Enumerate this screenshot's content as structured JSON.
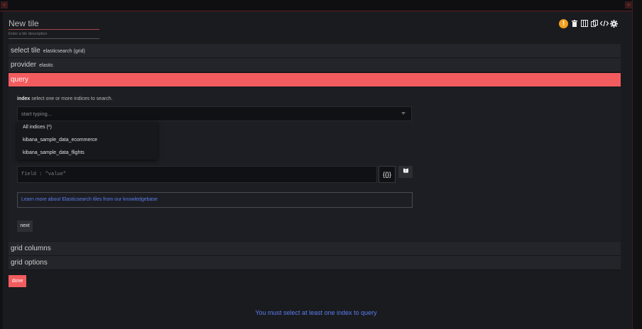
{
  "tile": {
    "title": "New tile",
    "description_placeholder": "Enter a tile description"
  },
  "toolbar": {
    "icons": [
      "warning-icon",
      "trash-icon",
      "columns-icon",
      "copy-icon",
      "code-icon",
      "gear-icon"
    ],
    "warning_glyph": "!"
  },
  "sections": {
    "select_tile": {
      "label": "select tile",
      "value": "elasticsearch (grid)"
    },
    "provider": {
      "label": "provider",
      "value": "elastic"
    },
    "query": {
      "label": "query"
    },
    "grid_columns": {
      "label": "grid columns"
    },
    "grid_options": {
      "label": "grid options"
    }
  },
  "query": {
    "index_label": "index",
    "index_hint": "select one or more indices to search.",
    "index_placeholder": "start typing...",
    "index_options": [
      "All indices (*)",
      "kibana_sample_data_ecommerce",
      "kibana_sample_data_flights"
    ],
    "query_placeholder": "field : \"value\"",
    "braces_label": "{{}}",
    "kb_link": "Learn more about Elasticsearch tiles from our knowledgebase",
    "next_label": "next"
  },
  "done_label": "done",
  "validation_message": "You must select at least one index to query",
  "colors": {
    "accent": "#f25c5f",
    "link": "#5b7df0",
    "warning": "#f0a020"
  }
}
